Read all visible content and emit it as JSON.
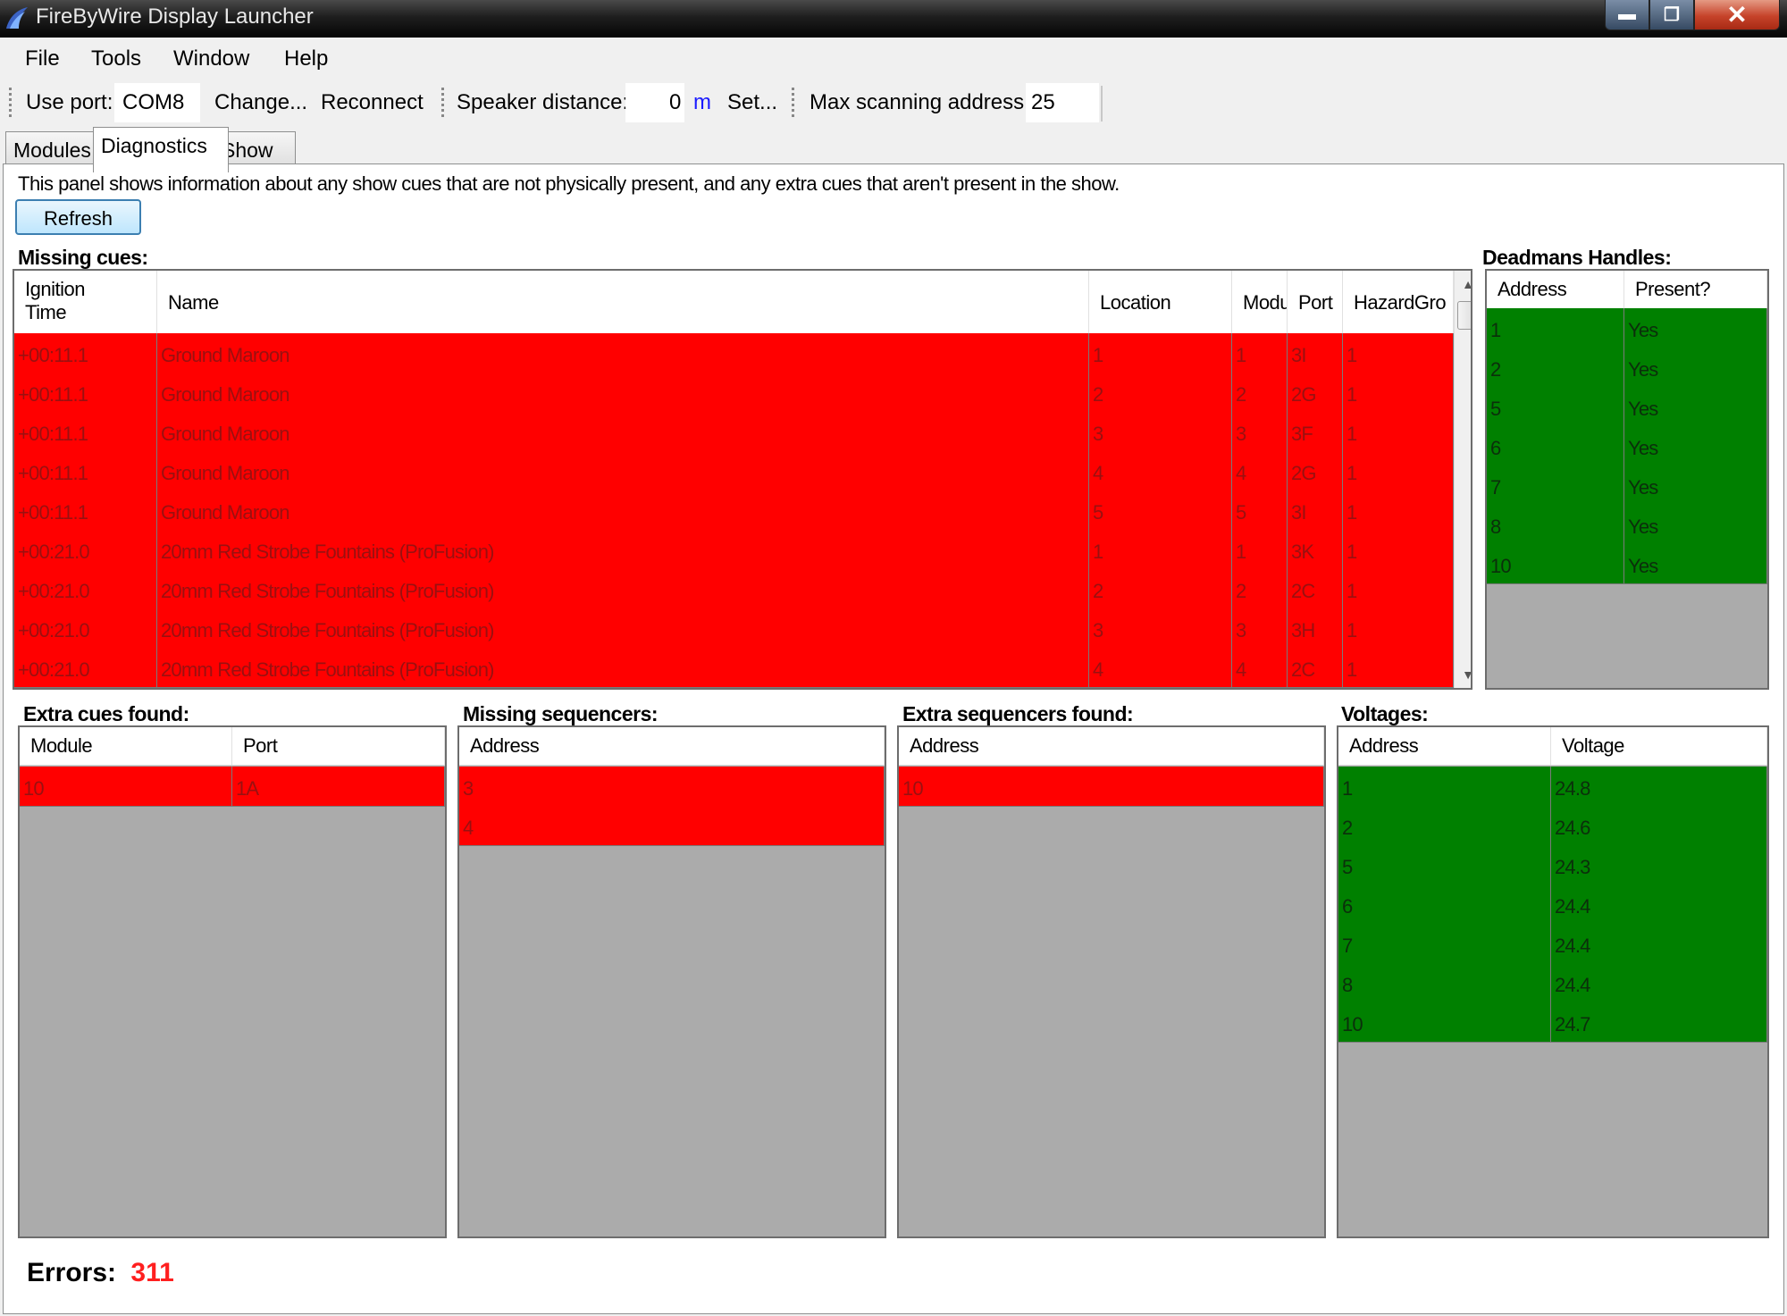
{
  "window": {
    "title": "FireByWire Display Launcher",
    "min": "▬",
    "max": "❐",
    "close": "✕"
  },
  "menu": [
    "File",
    "Tools",
    "Window",
    "Help"
  ],
  "toolbar": {
    "port_label": "Use port:",
    "port_value": "COM8",
    "change": "Change...",
    "reconnect": "Reconnect",
    "speaker_label": "Speaker distance:",
    "speaker_value": "0",
    "speaker_unit": "m",
    "set": "Set...",
    "maxaddr_label": "Max scanning address:",
    "maxaddr_value": "25"
  },
  "tabs": [
    "Modules",
    "Diagnostics",
    "Show"
  ],
  "active_tab": "Diagnostics",
  "description": "This panel shows information about any show cues that are not physically present, and any extra cues that aren't present in the show.",
  "refresh_label": "Refresh",
  "missing_cues": {
    "caption": "Missing cues:",
    "columns": [
      "Ignition\nTime",
      "Name",
      "Location",
      "Modu",
      "Port",
      "HazardGro"
    ],
    "rows": [
      [
        "+00:11.1",
        "Ground Maroon",
        "1",
        "1",
        "3I",
        "1"
      ],
      [
        "+00:11.1",
        "Ground Maroon",
        "2",
        "2",
        "2G",
        "1"
      ],
      [
        "+00:11.1",
        "Ground Maroon",
        "3",
        "3",
        "3F",
        "1"
      ],
      [
        "+00:11.1",
        "Ground Maroon",
        "4",
        "4",
        "2G",
        "1"
      ],
      [
        "+00:11.1",
        "Ground Maroon",
        "5",
        "5",
        "3I",
        "1"
      ],
      [
        "+00:21.0",
        "20mm Red Strobe Fountains (ProFusion)",
        "1",
        "1",
        "3K",
        "1"
      ],
      [
        "+00:21.0",
        "20mm Red Strobe Fountains (ProFusion)",
        "2",
        "2",
        "2C",
        "1"
      ],
      [
        "+00:21.0",
        "20mm Red Strobe Fountains (ProFusion)",
        "3",
        "3",
        "3H",
        "1"
      ],
      [
        "+00:21.0",
        "20mm Red Strobe Fountains (ProFusion)",
        "4",
        "4",
        "2C",
        "1"
      ]
    ]
  },
  "deadmans": {
    "caption": "Deadmans Handles:",
    "columns": [
      "Address",
      "Present?"
    ],
    "rows": [
      [
        "1",
        "Yes"
      ],
      [
        "2",
        "Yes"
      ],
      [
        "5",
        "Yes"
      ],
      [
        "6",
        "Yes"
      ],
      [
        "7",
        "Yes"
      ],
      [
        "8",
        "Yes"
      ],
      [
        "10",
        "Yes"
      ]
    ]
  },
  "extra_cues": {
    "caption": "Extra cues found:",
    "columns": [
      "Module",
      "Port"
    ],
    "rows": [
      [
        "10",
        "1A"
      ]
    ]
  },
  "missing_sequencers": {
    "caption": "Missing sequencers:",
    "columns": [
      "Address"
    ],
    "rows": [
      [
        "3"
      ],
      [
        "4"
      ]
    ]
  },
  "extra_sequencers": {
    "caption": "Extra sequencers found:",
    "columns": [
      "Address"
    ],
    "rows": [
      [
        "10"
      ]
    ]
  },
  "voltages": {
    "caption": "Voltages:",
    "columns": [
      "Address",
      "Voltage"
    ],
    "rows": [
      [
        "1",
        "24.8"
      ],
      [
        "2",
        "24.6"
      ],
      [
        "5",
        "24.3"
      ],
      [
        "6",
        "24.4"
      ],
      [
        "7",
        "24.4"
      ],
      [
        "8",
        "24.4"
      ],
      [
        "10",
        "24.7"
      ]
    ]
  },
  "errors": {
    "label": "Errors:",
    "value": "311"
  },
  "colors": {
    "missing": "#ff0000",
    "present": "#008000",
    "error_value": "#ff1f1f"
  }
}
